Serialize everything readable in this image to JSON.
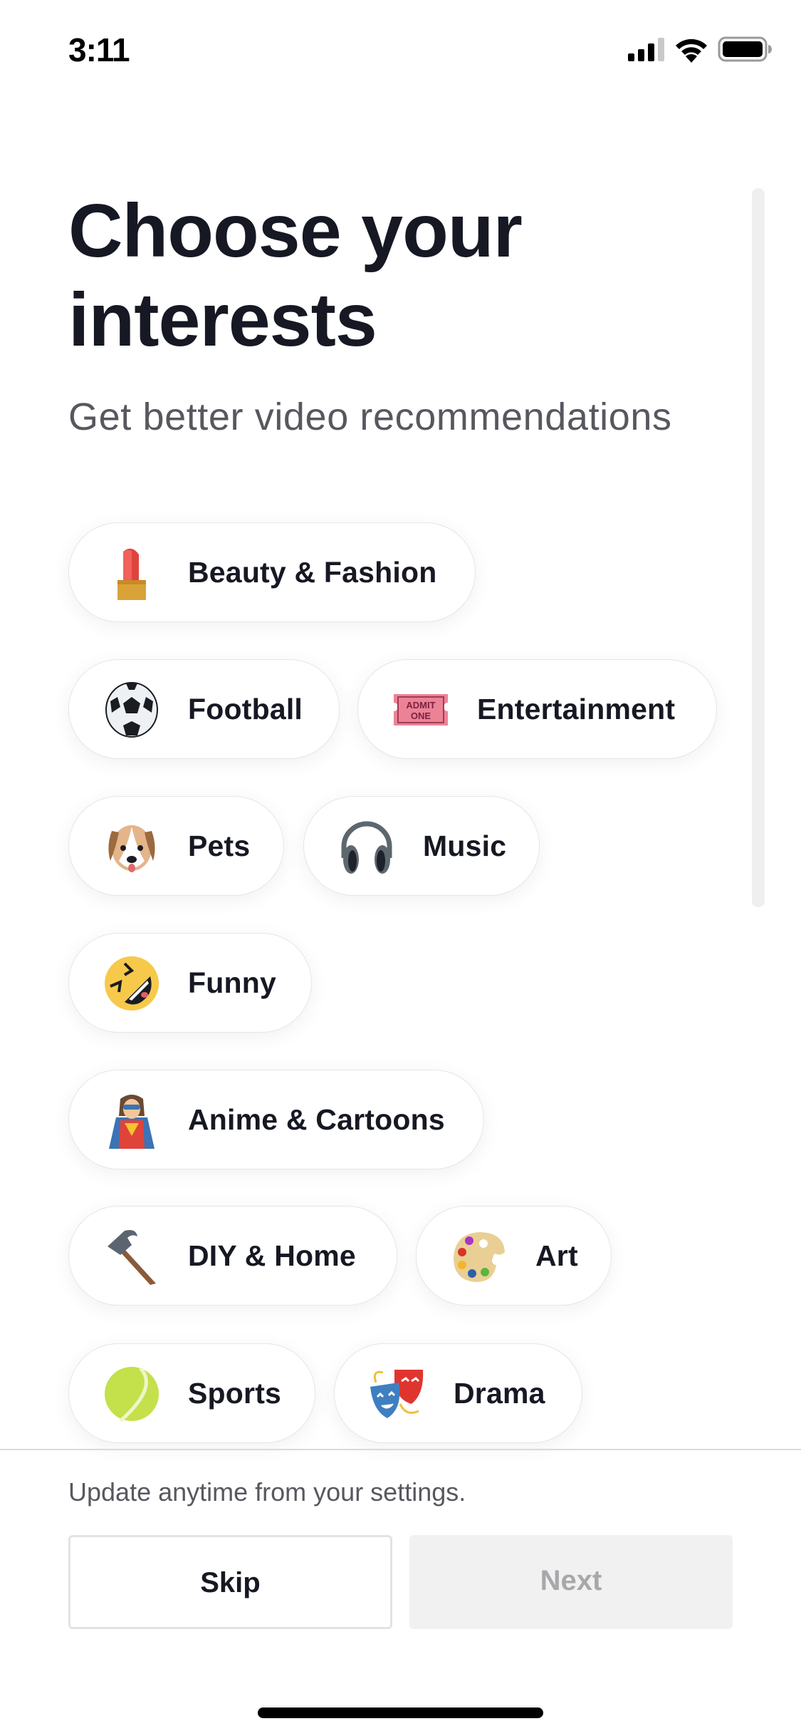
{
  "status_bar": {
    "time": "3:11",
    "signal_bars_filled": 3,
    "signal_bars_total": 4,
    "wifi_icon": "wifi-icon",
    "battery_icon": "battery-full-icon"
  },
  "header": {
    "title_line1": "Choose your",
    "title_line2": "interests",
    "subtitle": "Get better video recommendations"
  },
  "interests": [
    {
      "label": "Beauty & Fashion",
      "icon": "lipstick-icon",
      "selected": false
    },
    {
      "label": "Football",
      "icon": "soccer-ball-icon",
      "selected": false
    },
    {
      "label": "Entertainment",
      "icon": "admission-ticket-icon",
      "selected": false
    },
    {
      "label": "Pets",
      "icon": "dog-face-icon",
      "selected": false
    },
    {
      "label": "Music",
      "icon": "headphones-icon",
      "selected": false
    },
    {
      "label": "Funny",
      "icon": "rolling-laughing-face-icon",
      "selected": false
    },
    {
      "label": "Anime & Cartoons",
      "icon": "superhero-icon",
      "selected": false
    },
    {
      "label": "DIY & Home",
      "icon": "hammer-icon",
      "selected": false
    },
    {
      "label": "Art",
      "icon": "artist-palette-icon",
      "selected": false
    },
    {
      "label": "Sports",
      "icon": "tennis-ball-icon",
      "selected": false
    },
    {
      "label": "Drama",
      "icon": "performing-arts-icon",
      "selected": false
    }
  ],
  "footer": {
    "hint": "Update anytime from your settings.",
    "skip_label": "Skip",
    "next_label": "Next",
    "next_enabled": false
  },
  "colors": {
    "text_primary": "#161823",
    "text_secondary": "#57585f",
    "disabled_bg": "#f1f1f2",
    "disabled_text": "#a8a8ab"
  }
}
